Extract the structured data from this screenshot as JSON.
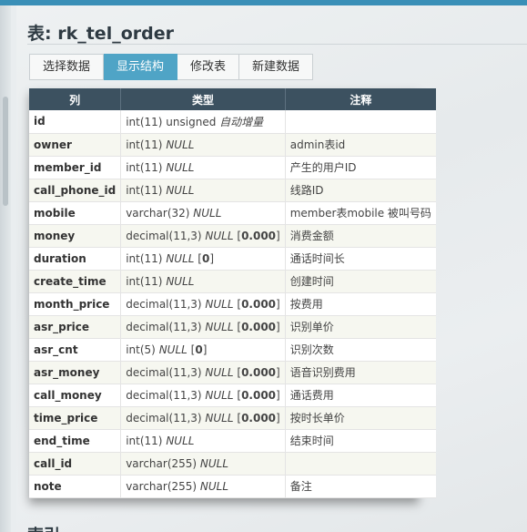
{
  "title": "表: rk_tel_order",
  "tabs": [
    "选择数据",
    "显示结构",
    "修改表",
    "新建数据"
  ],
  "active_tab": 1,
  "columns_header": [
    "列",
    "类型",
    "注释"
  ],
  "rows": [
    {
      "name": "id",
      "type": "int(11) unsigned",
      "extra": "自动增量",
      "null": "",
      "default": "",
      "comment": ""
    },
    {
      "name": "owner",
      "type": "int(11)",
      "extra": "",
      "null": "NULL",
      "default": "",
      "comment": "admin表id"
    },
    {
      "name": "member_id",
      "type": "int(11)",
      "extra": "",
      "null": "NULL",
      "default": "",
      "comment": "产生的用户ID"
    },
    {
      "name": "call_phone_id",
      "type": "int(11)",
      "extra": "",
      "null": "NULL",
      "default": "",
      "comment": "线路ID"
    },
    {
      "name": "mobile",
      "type": "varchar(32)",
      "extra": "",
      "null": "NULL",
      "default": "",
      "comment": "member表mobile 被叫号码"
    },
    {
      "name": "money",
      "type": "decimal(11,3)",
      "extra": "",
      "null": "NULL",
      "default": "0.000",
      "comment": "消费金额"
    },
    {
      "name": "duration",
      "type": "int(11)",
      "extra": "",
      "null": "NULL",
      "default": "0",
      "comment": "通话时间长"
    },
    {
      "name": "create_time",
      "type": "int(11)",
      "extra": "",
      "null": "NULL",
      "default": "",
      "comment": "创建时间"
    },
    {
      "name": "month_price",
      "type": "decimal(11,3)",
      "extra": "",
      "null": "NULL",
      "default": "0.000",
      "comment": "按费用"
    },
    {
      "name": "asr_price",
      "type": "decimal(11,3)",
      "extra": "",
      "null": "NULL",
      "default": "0.000",
      "comment": "识别单价"
    },
    {
      "name": "asr_cnt",
      "type": "int(5)",
      "extra": "",
      "null": "NULL",
      "default": "0",
      "comment": "识别次数"
    },
    {
      "name": "asr_money",
      "type": "decimal(11,3)",
      "extra": "",
      "null": "NULL",
      "default": "0.000",
      "comment": "语音识别费用"
    },
    {
      "name": "call_money",
      "type": "decimal(11,3)",
      "extra": "",
      "null": "NULL",
      "default": "0.000",
      "comment": "通话费用"
    },
    {
      "name": "time_price",
      "type": "decimal(11,3)",
      "extra": "",
      "null": "NULL",
      "default": "0.000",
      "comment": "按时长单价"
    },
    {
      "name": "end_time",
      "type": "int(11)",
      "extra": "",
      "null": "NULL",
      "default": "",
      "comment": "结束时间"
    },
    {
      "name": "call_id",
      "type": "varchar(255)",
      "extra": "",
      "null": "NULL",
      "default": "",
      "comment": ""
    },
    {
      "name": "note",
      "type": "varchar(255)",
      "extra": "",
      "null": "NULL",
      "default": "",
      "comment": "备注"
    }
  ],
  "next_section": "索引",
  "colors": {
    "accent": "#3a8fb7",
    "active_tab": "#4fa4c6",
    "table_header": "#3c5160"
  }
}
